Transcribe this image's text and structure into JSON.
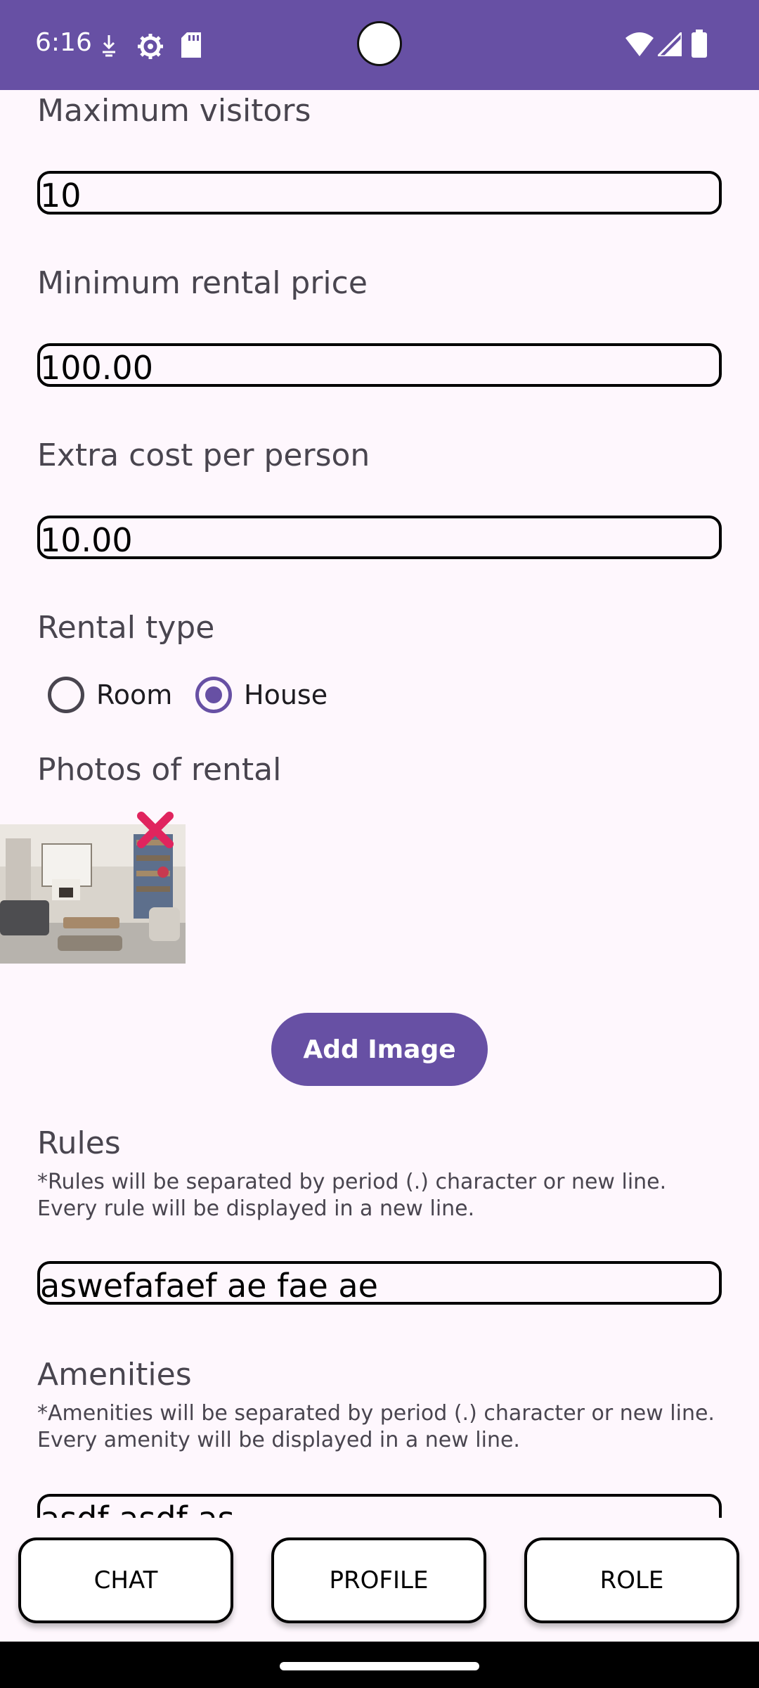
{
  "status_bar": {
    "time": "6:16"
  },
  "form": {
    "max_visitors_label": "Maximum visitors",
    "max_visitors_value": "10",
    "min_price_label": "Minimum rental price",
    "min_price_value": "100.00",
    "extra_cost_label": "Extra cost per person",
    "extra_cost_value": "10.00",
    "rental_type_label": "Rental type",
    "rental_type_options": [
      "Room",
      "House"
    ],
    "rental_type_selected": "House",
    "photos_label": "Photos of rental",
    "add_image_label": "Add Image",
    "rules_label": "Rules",
    "rules_hint_line1": "*Rules will be separated by period (.) character or new line.",
    "rules_hint_line2": "Every rule will be displayed in a new line.",
    "rules_value": "aswefafaef ae fae ae",
    "amenities_label": "Amenities",
    "amenities_hint_line1": "*Amenities will be separated by period (.) character or new line.",
    "amenities_hint_line2": "Every amenity will be displayed in a new line.",
    "amenities_value": "asdf asdf as"
  },
  "bottom_nav": {
    "chat": "CHAT",
    "profile": "PROFILE",
    "role": "ROLE"
  },
  "colors": {
    "primary": "#6750a4",
    "background": "#fef7fd",
    "remove_icon": "#e0245e"
  },
  "icons": [
    "signal-icon",
    "wifi-icon",
    "battery-icon",
    "settings-icon",
    "sd-card-icon",
    "close-icon"
  ]
}
